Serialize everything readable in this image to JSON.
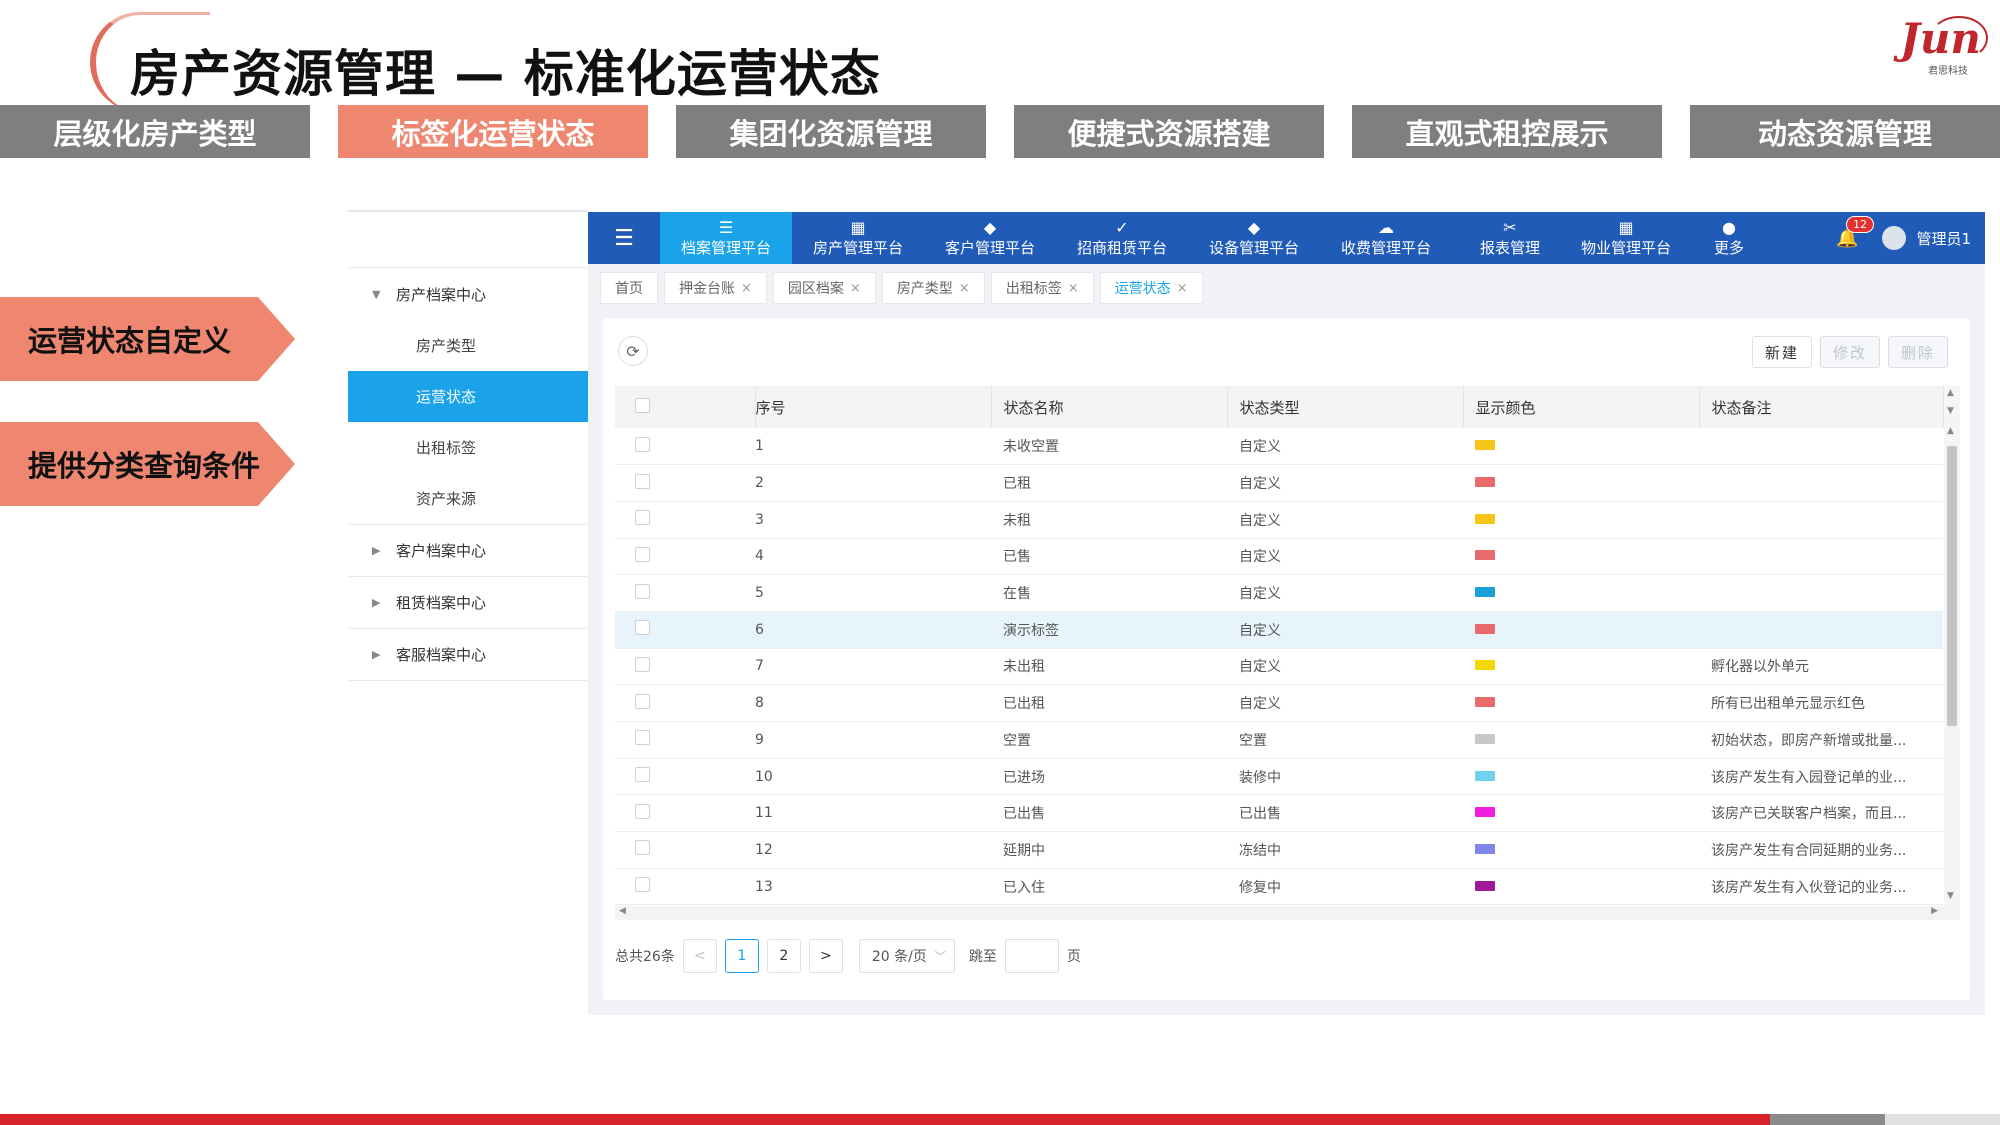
{
  "slide": {
    "title": "房产资源管理 — 标准化运营状态",
    "logo_text": "Jun",
    "logo_subtext": "君思科技"
  },
  "feature_tabs": [
    {
      "label": "层级化房产类型",
      "active": false
    },
    {
      "label": "标签化运营状态",
      "active": true
    },
    {
      "label": "集团化资源管理",
      "active": false
    },
    {
      "label": "便捷式资源搭建",
      "active": false
    },
    {
      "label": "直观式租控展示",
      "active": false
    },
    {
      "label": "动态资源管理",
      "active": false
    }
  ],
  "callouts": [
    "运营状态自定义",
    "提供分类查询条件"
  ],
  "sidebar": {
    "groups": [
      {
        "label": "房产档案中心",
        "expanded": true,
        "items": [
          {
            "label": "房产类型",
            "active": false
          },
          {
            "label": "运营状态",
            "active": true
          },
          {
            "label": "出租标签",
            "active": false
          },
          {
            "label": "资产来源",
            "active": false
          }
        ]
      },
      {
        "label": "客户档案中心",
        "expanded": false,
        "items": []
      },
      {
        "label": "租赁档案中心",
        "expanded": false,
        "items": []
      },
      {
        "label": "客服档案中心",
        "expanded": false,
        "items": []
      }
    ]
  },
  "topnav": {
    "menu_icon": "menu-toggle-icon",
    "items": [
      {
        "label": "档案管理平台",
        "icon": "archive-icon",
        "active": true
      },
      {
        "label": "房产管理平台",
        "icon": "building-icon",
        "active": false
      },
      {
        "label": "客户管理平台",
        "icon": "customer-icon",
        "active": false
      },
      {
        "label": "招商租赁平台",
        "icon": "check-icon",
        "active": false
      },
      {
        "label": "设备管理平台",
        "icon": "device-icon",
        "active": false
      },
      {
        "label": "收费管理平台",
        "icon": "payment-icon",
        "active": false
      },
      {
        "label": "报表管理",
        "icon": "report-icon",
        "active": false
      },
      {
        "label": "物业管理平台",
        "icon": "property-icon",
        "active": false
      },
      {
        "label": "更多",
        "icon": "more-icon",
        "active": false
      }
    ],
    "notifications": "12",
    "user": "管理员1"
  },
  "page_tabs": [
    {
      "label": "首页",
      "closable": false,
      "active": false
    },
    {
      "label": "押金台账",
      "closable": true,
      "active": false
    },
    {
      "label": "园区档案",
      "closable": true,
      "active": false
    },
    {
      "label": "房产类型",
      "closable": true,
      "active": false
    },
    {
      "label": "出租标签",
      "closable": true,
      "active": false
    },
    {
      "label": "运营状态",
      "closable": true,
      "active": true
    }
  ],
  "toolbar": {
    "new": "新建",
    "edit": "修改",
    "delete": "删除"
  },
  "table": {
    "columns": [
      "序号",
      "状态名称",
      "状态类型",
      "显示颜色",
      "状态备注"
    ],
    "rows": [
      {
        "no": "1",
        "name": "未收空置",
        "type": "自定义",
        "color": "#f5c518",
        "note": ""
      },
      {
        "no": "2",
        "name": "已租",
        "type": "自定义",
        "color": "#e86a6a",
        "note": ""
      },
      {
        "no": "3",
        "name": "未租",
        "type": "自定义",
        "color": "#f5c518",
        "note": ""
      },
      {
        "no": "4",
        "name": "已售",
        "type": "自定义",
        "color": "#e86a6a",
        "note": ""
      },
      {
        "no": "5",
        "name": "在售",
        "type": "自定义",
        "color": "#1a9fdb",
        "note": ""
      },
      {
        "no": "6",
        "name": "演示标签",
        "type": "自定义",
        "color": "#e86a6a",
        "note": "",
        "highlight": true
      },
      {
        "no": "7",
        "name": "未出租",
        "type": "自定义",
        "color": "#f5d800",
        "note": "孵化器以外单元"
      },
      {
        "no": "8",
        "name": "已出租",
        "type": "自定义",
        "color": "#e86a6a",
        "note": "所有已出租单元显示红色"
      },
      {
        "no": "9",
        "name": "空置",
        "type": "空置",
        "color": "#c8c8c8",
        "note": "初始状态，即房产新增或批量..."
      },
      {
        "no": "10",
        "name": "已进场",
        "type": "装修中",
        "color": "#6fd0f0",
        "note": "该房产发生有入园登记单的业..."
      },
      {
        "no": "11",
        "name": "已出售",
        "type": "已出售",
        "color": "#ee1de0",
        "note": "该房产已关联客户档案，而且..."
      },
      {
        "no": "12",
        "name": "延期中",
        "type": "冻结中",
        "color": "#8085e8",
        "note": "该房产发生有合同延期的业务..."
      },
      {
        "no": "13",
        "name": "已入住",
        "type": "修复中",
        "color": "#a0199a",
        "note": "该房产发生有入伙登记的业务..."
      }
    ]
  },
  "pagination": {
    "total": "总共26条",
    "prev": "<",
    "pages": [
      "1",
      "2"
    ],
    "current": "1",
    "next": ">",
    "page_size": "20 条/页",
    "jump_label": "跳至",
    "page_unit": "页"
  }
}
